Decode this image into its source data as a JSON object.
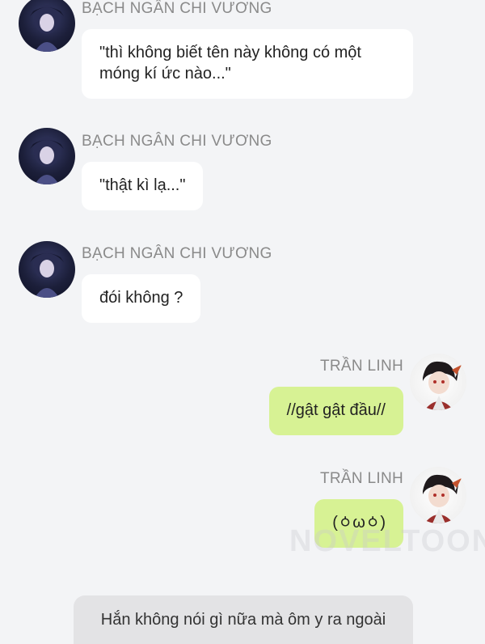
{
  "messages": [
    {
      "side": "left",
      "name": "BẠCH NGÂN CHI VƯƠNG",
      "lines": [
        "\"thì không biết tên này không có một",
        "móng kí ức nào...\""
      ]
    },
    {
      "side": "left",
      "name": "BẠCH NGÂN CHI VƯƠNG",
      "lines": [
        "\"thật kì lạ...\""
      ]
    },
    {
      "side": "left",
      "name": "BẠCH NGÂN CHI VƯƠNG",
      "lines": [
        "đói không ?"
      ]
    },
    {
      "side": "right",
      "name": "TRẦN LINH",
      "lines": [
        "//gật gật đầu//"
      ]
    },
    {
      "side": "right",
      "name": "TRẦN LINH",
      "lines": [
        "(ㆁωㆁ)"
      ]
    }
  ],
  "narration": "Hắn không nói gì nữa mà ôm y ra ngoài",
  "watermark": "NOVELTOON",
  "colors": {
    "background": "#f3f4f6",
    "left_bubble": "#ffffff",
    "right_bubble": "#d7f294",
    "name": "#8a8a8a"
  }
}
